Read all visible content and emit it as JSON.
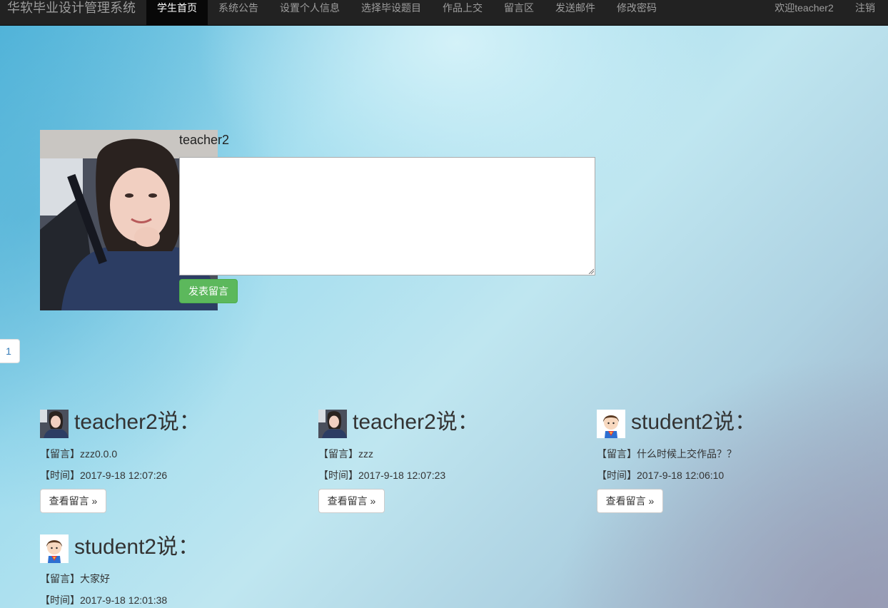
{
  "nav": {
    "brand": "华软毕业设计管理系统",
    "items": [
      {
        "label": "学生首页",
        "active": true
      },
      {
        "label": "系统公告",
        "active": false
      },
      {
        "label": "设置个人信息",
        "active": false
      },
      {
        "label": "选择毕设题目",
        "active": false
      },
      {
        "label": "作品上交",
        "active": false
      },
      {
        "label": "留言区",
        "active": false
      },
      {
        "label": "发送邮件",
        "active": false
      },
      {
        "label": "修改密码",
        "active": false
      }
    ],
    "welcome": "欢迎teacher2",
    "logout": "注销"
  },
  "post_form": {
    "username": "teacher2",
    "textarea_value": "",
    "submit_label": "发表留言"
  },
  "pagination": {
    "current_page": "1"
  },
  "comments": [
    {
      "title": "teacher2说：",
      "message": "【留言】zzz0.0.0",
      "time": "【时间】2017-9-18 12:07:26",
      "button": "查看留言 »",
      "avatar": "teacher"
    },
    {
      "title": "teacher2说：",
      "message": "【留言】zzz",
      "time": "【时间】2017-9-18 12:07:23",
      "button": "查看留言 »",
      "avatar": "teacher"
    },
    {
      "title": "student2说：",
      "message": "【留言】什么时候上交作品？？",
      "time": "【时间】2017-9-18 12:06:10",
      "button": "查看留言 »",
      "avatar": "student"
    },
    {
      "title": "student2说：",
      "message": "【留言】大家好",
      "time": "【时间】2017-9-18 12:01:38",
      "button": "",
      "avatar": "student"
    }
  ],
  "colors": {
    "navbar": "#222222",
    "nav_active": "#080808",
    "success_button": "#5cb85c",
    "link": "#337ab7"
  }
}
